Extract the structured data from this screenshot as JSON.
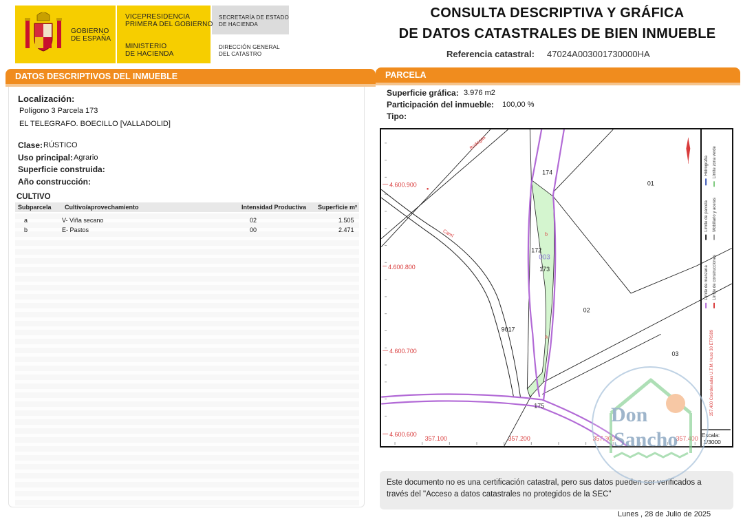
{
  "header": {
    "gov_line1": "GOBIERNO",
    "gov_line2": "DE ESPAÑA",
    "vice_line1": "VICEPRESIDENCIA",
    "vice_line2": "PRIMERA DEL GOBIERNO",
    "min_line1": "MINISTERIO",
    "min_line2": "DE HACIENDA",
    "sec_line1": "SECRETARÍA DE ESTADO",
    "sec_line2": "DE HACIENDA",
    "dir_line1": "DIRECCIÓN GENERAL",
    "dir_line2": "DEL CATASTRO",
    "title_line1": "CONSULTA DESCRIPTIVA Y GRÁFICA",
    "title_line2": "DE DATOS CATASTRALES DE BIEN INMUEBLE",
    "ref_label": "Referencia catastral:",
    "ref_value": "47024A003001730000HA"
  },
  "left": {
    "section_title": "DATOS DESCRIPTIVOS DEL INMUEBLE",
    "localizacion_label": "Localización:",
    "loc_line1": "Polígono 3 Parcela 173",
    "loc_line2": "EL TELEGRAFO. BOECILLO [VALLADOLID]",
    "clase_label": "Clase:",
    "clase_value": "RÚSTICO",
    "uso_label": "Uso principal:",
    "uso_value": "Agrario",
    "sup_label": "Superficie construida:",
    "anio_label": "Año construcción:",
    "cultivo_title": "CULTIVO",
    "table": {
      "headers": [
        "Subparcela",
        "Cultivo/aprovechamiento",
        "Intensidad Productiva",
        "Superficie m²"
      ],
      "rows": [
        [
          "a",
          "V- Viña secano",
          "02",
          "1.505"
        ],
        [
          "b",
          "E- Pastos",
          "00",
          "2.471"
        ]
      ]
    }
  },
  "right": {
    "section_title": "PARCELA",
    "sup_grafica_label": "Superficie gráfica:",
    "sup_grafica_value": "3.976 m2",
    "participacion_label": "Participación del inmueble:",
    "participacion_value": "100,00 %",
    "tipo_label": "Tipo:"
  },
  "map": {
    "y_labels": [
      "4.600.900",
      "4.600.800",
      "4.600.700",
      "4.600.600"
    ],
    "x_labels": [
      "357.100",
      "357.200",
      "357.300",
      "357.400"
    ],
    "parcel_labels": [
      "174",
      "01",
      "172",
      "003",
      "173",
      "02",
      "9017",
      "03",
      "175"
    ],
    "subparcel_labels": [
      "b",
      "a"
    ],
    "road_labels": [
      "Bodegas",
      "Camí"
    ],
    "legend": {
      "col1": [
        "Límite de parcela",
        "Hidrografía"
      ],
      "col2": [
        "Mobiliario y aceras",
        "Límite zona verde"
      ],
      "col3": [
        "Límite de manzana",
        "Límite de construcciones"
      ],
      "coords": "357.400 Coordenadas U.T.M. Huso 30 ETRS89"
    },
    "scale_label": "Escala:",
    "scale_value": "1/3000",
    "colors": {
      "parcel_fill": "#d4f5cf",
      "boundary": "#b26ad6",
      "grid_text": "#d93b3b"
    }
  },
  "notice": "Este documento no es una certificación catastral, pero sus datos pueden ser verificados a través del \"Acceso a datos catastrales no protegidos de la SEC\"",
  "date": "Lunes , 28 de Julio de 2025",
  "watermark": {
    "line1": "Don",
    "line2": "Sancho"
  }
}
